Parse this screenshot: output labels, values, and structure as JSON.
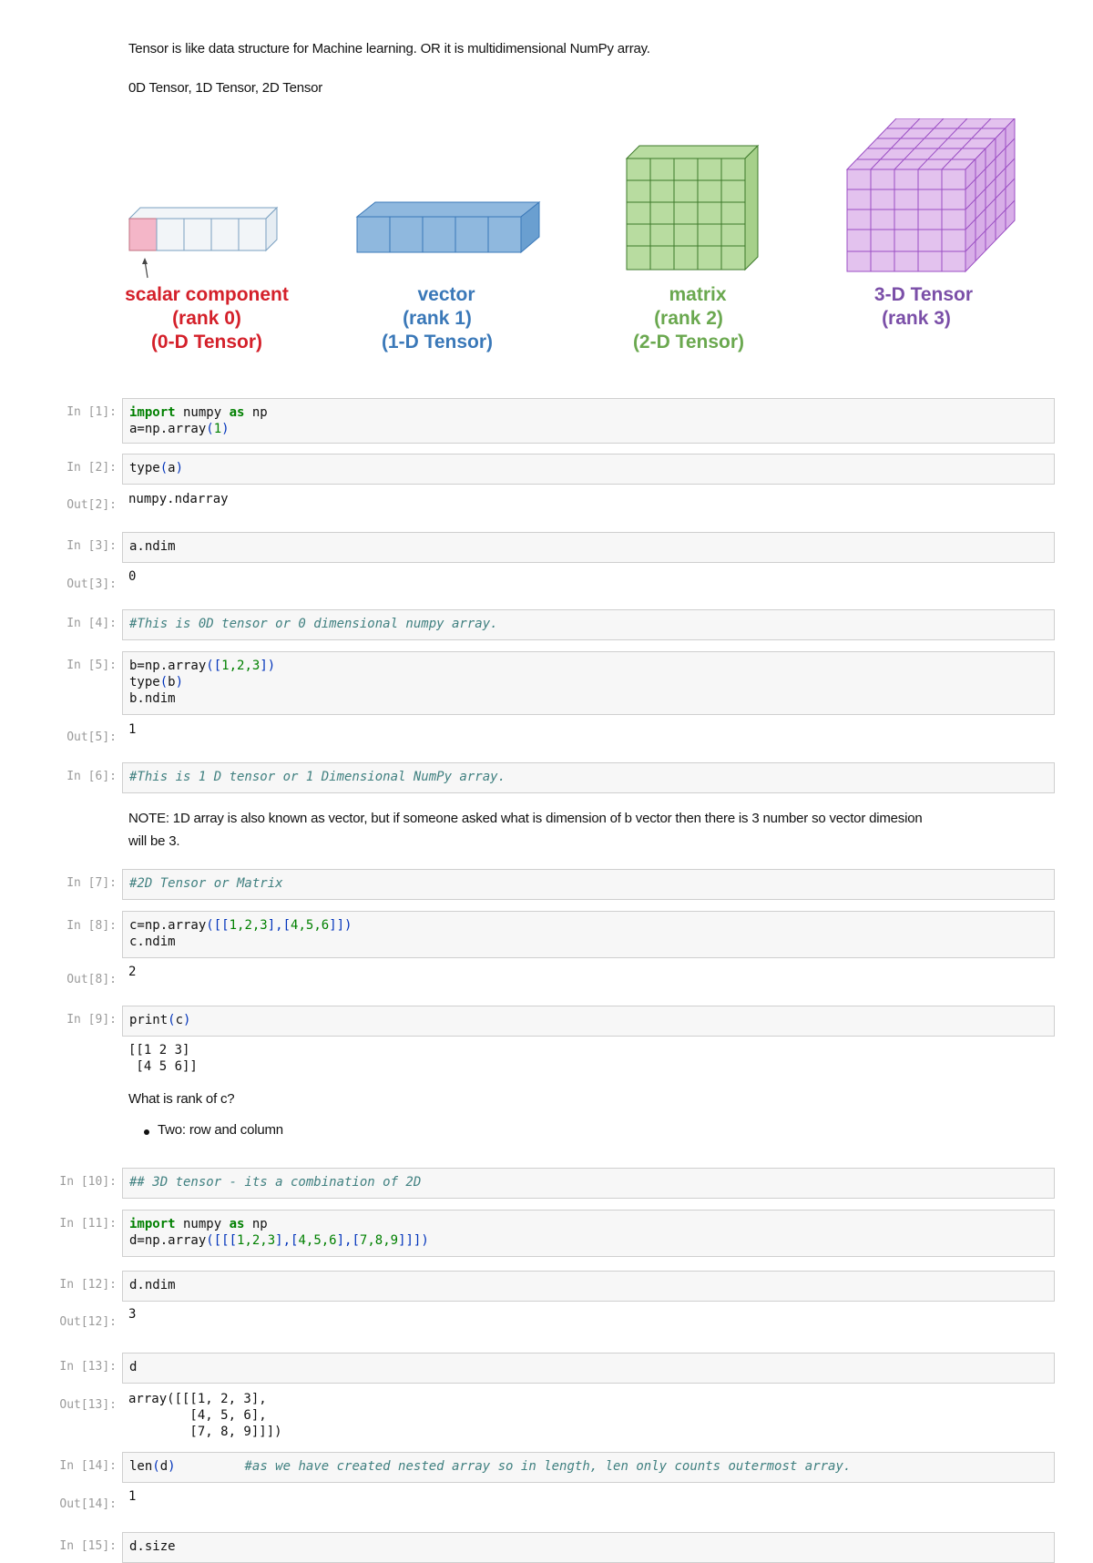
{
  "intro": {
    "line1": "Tensor is like data structure for Machine learning. OR it is multidimensional NumPy array.",
    "line2": "0D Tensor, 1D Tensor, 2D Tensor"
  },
  "figure": {
    "scalar": {
      "l1": "scalar component",
      "l2": "(rank 0)",
      "l3": "(0-D Tensor)",
      "color": "#d4202a"
    },
    "vector": {
      "l1": "vector",
      "l2": "(rank 1)",
      "l3": "(1-D Tensor)",
      "color": "#3a78b8"
    },
    "matrix": {
      "l1": "matrix",
      "l2": "(rank 2)",
      "l3": "(2-D Tensor)",
      "color": "#6aa84f"
    },
    "tensor": {
      "l1": "3-D Tensor",
      "l2": "(rank 3)",
      "color": "#7b4fa8"
    }
  },
  "cells": {
    "c1": {
      "in": "In [1]:"
    },
    "c2": {
      "in": "In [2]:",
      "out": "Out[2]:",
      "output": "numpy.ndarray"
    },
    "c3": {
      "in": "In [3]:",
      "out": "Out[3]:",
      "output": "0"
    },
    "c4": {
      "in": "In [4]:",
      "code": "#This is 0D tensor or 0 dimensional numpy array."
    },
    "c5": {
      "in": "In [5]:",
      "out": "Out[5]:",
      "output": "1"
    },
    "c6": {
      "in": "In [6]:",
      "code": "#This is 1 D tensor or 1 Dimensional NumPy array."
    },
    "note": {
      "line1": "NOTE: 1D array is also known as vector, but if someone asked what is dimension of b vector then there is 3 number so vector dimesion",
      "line2": "will be 3."
    },
    "c7": {
      "in": "In [7]:",
      "code": "#2D Tensor or Matrix"
    },
    "c8": {
      "in": "In [8]:",
      "out": "Out[8]:",
      "output": "2"
    },
    "c9": {
      "in": "In [9]:",
      "output": "[[1 2 3]\n [4 5 6]]"
    },
    "rank_q": "What is rank of c?",
    "rank_a": "Two: row and column",
    "c10": {
      "in": "In [10]:",
      "code": "## 3D tensor - its a combination of 2D"
    },
    "c11": {
      "in": "In [11]:"
    },
    "c12": {
      "in": "In [12]:",
      "out": "Out[12]:",
      "output": "3"
    },
    "c13": {
      "in": "In [13]:",
      "out": "Out[13]:",
      "output": "array([[[1, 2, 3],\n        [4, 5, 6],\n        [7, 8, 9]]])"
    },
    "c14": {
      "in": "In [14]:",
      "out": "Out[14]:",
      "comment": "#as we have created nested array so in length, len only counts outermost array.",
      "output": "1"
    },
    "c15": {
      "in": "In [15]:",
      "code": "d.size"
    }
  },
  "code_tokens": {
    "import": "import",
    "numpy": " numpy ",
    "as": "as",
    "np": " np",
    "a_assign": "a=np.array",
    "lp": "(",
    "rp": ")",
    "one": "1",
    "type_a": "type",
    "a": "a",
    "a_ndim": "a.ndim",
    "b_assign": "b=np.array",
    "b_list_open": "([",
    "b_list_close": "])",
    "nums123": "1,2,3",
    "type_b": "type",
    "b": "b",
    "b_ndim": "b.ndim",
    "c_assign": "c=np.array",
    "c_open": "([[",
    "c_mid": "],[",
    "nums456": "4,5,6",
    "c_close": "]])",
    "c_ndim": "c.ndim",
    "print": "print",
    "c": "c",
    "d_assign": "d=np.array",
    "d_open": "([[[",
    "nums789": "7,8,9",
    "d_close": "]]])",
    "d_ndim": "d.ndim",
    "d": "d",
    "len": "len"
  }
}
